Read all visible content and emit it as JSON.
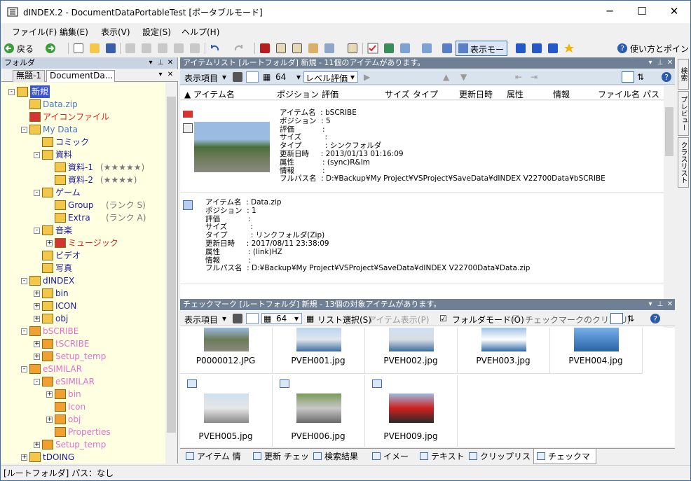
{
  "window": {
    "title": "dINDEX.2 - DocumentDataPortableTest [ポータブルモード]",
    "minimize_glyph": "─",
    "maximize_glyph": "☐",
    "close_glyph": "✕"
  },
  "menu": [
    "ファイル(F)",
    "編集(E)",
    "表示(V)",
    "設定(S)",
    "ヘルプ(H)"
  ],
  "toolbar": {
    "back_label": "戻る",
    "display_mode_label": "表示モード",
    "help_label": "使い方とポイント"
  },
  "folder_pane": {
    "header": "フォルダ",
    "tabs": [
      "無題-1",
      "DocumentDa..."
    ],
    "tree": [
      {
        "label": "新規",
        "depth": 0,
        "color": "#ffffff",
        "selected": true,
        "expander": "-"
      },
      {
        "label": "Data.zip",
        "depth": 1,
        "color": "#4a78c9",
        "expander": ""
      },
      {
        "label": "アイコンファイル",
        "depth": 1,
        "color": "#e02020",
        "expander": ""
      },
      {
        "label": "My Data",
        "depth": 1,
        "color": "#4a78c9",
        "expander": "-"
      },
      {
        "label": "コミック",
        "depth": 2,
        "color": "#1a1aa0",
        "expander": ""
      },
      {
        "label": "資料",
        "depth": 2,
        "color": "#1a1aa0",
        "expander": "-"
      },
      {
        "label": "資料-1",
        "suffix": "(★★★★★)",
        "depth": 3,
        "color": "#1a1aa0",
        "expander": ""
      },
      {
        "label": "資料-2",
        "suffix": "(★★★★)",
        "depth": 3,
        "color": "#1a1aa0",
        "expander": ""
      },
      {
        "label": "ゲーム",
        "depth": 2,
        "color": "#1a1aa0",
        "expander": "-"
      },
      {
        "label": "Group",
        "suffix": "(ランク S)",
        "depth": 3,
        "color": "#1a1aa0",
        "expander": ""
      },
      {
        "label": "Extra",
        "suffix": "(ランク A)",
        "depth": 3,
        "color": "#1a1aa0",
        "expander": ""
      },
      {
        "label": "音楽",
        "depth": 2,
        "color": "#1a1aa0",
        "expander": "-"
      },
      {
        "label": "ミュージック",
        "depth": 3,
        "color": "#e02020",
        "expander": "+"
      },
      {
        "label": "ビデオ",
        "depth": 2,
        "color": "#1a1aa0",
        "expander": ""
      },
      {
        "label": "写真",
        "depth": 2,
        "color": "#1a1aa0",
        "expander": ""
      },
      {
        "label": "dINDEX",
        "depth": 1,
        "color": "#1a1aa0",
        "expander": "-"
      },
      {
        "label": "bin",
        "depth": 2,
        "color": "#1a1aa0",
        "expander": "+"
      },
      {
        "label": "ICON",
        "depth": 2,
        "color": "#1a1aa0",
        "expander": "+"
      },
      {
        "label": "obj",
        "depth": 2,
        "color": "#1a1aa0",
        "expander": "+"
      },
      {
        "label": "bSCRIBE",
        "depth": 1,
        "color": "#e06fd0",
        "expander": "-"
      },
      {
        "label": "tSCRIBE",
        "depth": 2,
        "color": "#e06fd0",
        "expander": "+"
      },
      {
        "label": "Setup_temp",
        "depth": 2,
        "color": "#e06fd0",
        "expander": "+"
      },
      {
        "label": "eSIMILAR",
        "depth": 1,
        "color": "#e06fd0",
        "expander": "-"
      },
      {
        "label": "eSIMILAR",
        "depth": 2,
        "color": "#e06fd0",
        "expander": "-"
      },
      {
        "label": "bin",
        "depth": 3,
        "color": "#e06fd0",
        "expander": "+"
      },
      {
        "label": "Icon",
        "depth": 3,
        "color": "#e06fd0",
        "expander": ""
      },
      {
        "label": "obj",
        "depth": 3,
        "color": "#e06fd0",
        "expander": "+"
      },
      {
        "label": "Properties",
        "depth": 3,
        "color": "#e06fd0",
        "expander": ""
      },
      {
        "label": "Setup_temp",
        "depth": 2,
        "color": "#e06fd0",
        "expander": "+"
      },
      {
        "label": "tDOING",
        "depth": 1,
        "color": "#1a1aa0",
        "expander": "+"
      }
    ]
  },
  "item_list": {
    "header": "アイテムリスト  [ルートフォルダ]  新規 - 11個のアイテムがあります。",
    "toolbar_display_items": "表示項目",
    "toolbar_size": "64",
    "toolbar_level": "レベル評価",
    "columns": [
      "▲ アイテム名",
      "ポジション",
      "評価",
      "サイズ",
      "タイプ",
      "更新日時",
      "属性",
      "情報",
      "ファイル名",
      "パス名"
    ],
    "items": [
      {
        "text": "アイテム名  : bSCRIBE\nポジション  : 5\n評価            :\nサイズ          :\nタイプ          : シンクフォルダ\n更新日時     : 2013/01/13 01:16:09\n属性            : (sync)R&lm\n情報            :\nフルパス名  : D:¥Backup¥My Project¥VSProject¥SaveData¥dINDEX V22700Data¥bSCRIBE",
        "color": "#e06fd0"
      },
      {
        "text": "アイテム名  : Data.zip\nポジション  : 1\n評価            :\nサイズ          :\nタイプ          : リンクフォルダ(Zip)\n更新日時     : 2017/08/11 23:38:09\n属性            : (link)HZ\n情報            :\nフルパス名  : D:¥Backup¥My Project¥VSProject¥SaveData¥dINDEX V22700Data¥Data.zip",
        "color": "#4a78c9"
      }
    ]
  },
  "checkmark": {
    "header": "チェックマーク  [ルートフォルダ]  新規 - 13個の対象アイテムがあります。",
    "toolbar_display_items": "表示項目",
    "toolbar_size": "64",
    "list_select": "リスト選択(S)",
    "item_display": "アイテム表示(P)",
    "folder_mode": "フォルダモード(O)",
    "clear_check": "チェックマークのクリア(U)",
    "thumbs_row1": [
      "P0000012.JPG",
      "PVEH001.jpg",
      "PVEH002.jpg",
      "PVEH003.jpg",
      "PVEH004.jpg"
    ],
    "thumbs_row2": [
      "PVEH005.jpg",
      "PVEH006.jpg",
      "PVEH009.jpg"
    ]
  },
  "bottom_tabs": [
    "アイテム 情報",
    "更新 チェック",
    "検索結果",
    "イメージ",
    "テキスト",
    "クリップリスト",
    "チェックマーク"
  ],
  "side_tabs": [
    "検索",
    "プレビュー",
    "クラスリスト"
  ],
  "status": "[ルートフォルダ] パス：なし"
}
